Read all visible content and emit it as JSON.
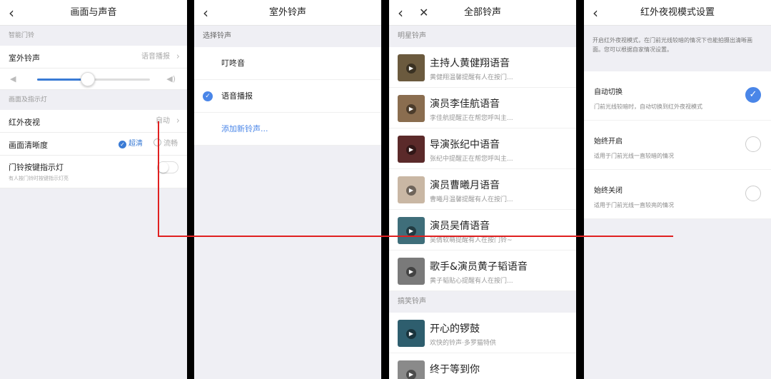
{
  "colors": {
    "accent": "#4a86e8",
    "annotation": "#e02020"
  },
  "screen1": {
    "title": "画面与声音",
    "section_smart_bell": "智能门铃",
    "outdoor_ring_label": "室外铃声",
    "outdoor_ring_value": "语音播报",
    "volume_level": 0.45,
    "section_picture": "画面及指示灯",
    "ir_night_label": "红外夜视",
    "ir_night_value": "自动",
    "clarity_label": "画面清晰度",
    "clarity_options": [
      "超清",
      "流畅"
    ],
    "clarity_selected": "超清",
    "indicator_label": "门铃按键指示灯",
    "indicator_sub": "有人按门铃时按键指示灯亮",
    "indicator_on": false
  },
  "screen2": {
    "title": "室外铃声",
    "section": "选择铃声",
    "options": [
      "叮咚音",
      "语音播报"
    ],
    "selected": "语音播报",
    "add_new": "添加新铃声..."
  },
  "screen3": {
    "title": "全部铃声",
    "section_star": "明星铃声",
    "star_items": [
      {
        "title": "主持人黄健翔语音",
        "sub": "黄健翔温馨提醒有人在按门...",
        "color": "#6b5a3e"
      },
      {
        "title": "演员李佳航语音",
        "sub": "李佳航提醒正在帮您呼叫主...",
        "color": "#8a6d4f"
      },
      {
        "title": "导演张纪中语音",
        "sub": "张纪中提醒正在帮您呼叫主...",
        "color": "#5b2a2a"
      },
      {
        "title": "演员曹曦月语音",
        "sub": "曹曦月温馨提醒有人在按门...",
        "color": "#c9b7a4"
      },
      {
        "title": "演员吴倩语音",
        "sub": "吴倩软萌提醒有人在按门铃~",
        "color": "#3f6e7a"
      },
      {
        "title": "歌手&演员黄子韬语音",
        "sub": "黄子韬贴心提醒有人在按门...",
        "color": "#7a7a7a"
      }
    ],
    "section_funny": "搞笑铃声",
    "funny_items": [
      {
        "title": "开心的锣鼓",
        "sub": "欢快的铃声·多罗猫特供",
        "color": "#2e5e6e"
      },
      {
        "title": "终于等到你",
        "sub": "",
        "color": "#8a8a8a"
      }
    ]
  },
  "screen4": {
    "title": "红外夜视模式设置",
    "description": "开启红外夜视模式，在门前光线较暗的情况下也能拍摄出清晰画面。您可以根据自家情况设置。",
    "modes": [
      {
        "title": "自动切换",
        "sub": "门前光线较暗时，自动切换到红外夜视模式",
        "selected": true
      },
      {
        "title": "始终开启",
        "sub": "适用于门前光线一直较暗的情况",
        "selected": false
      },
      {
        "title": "始终关闭",
        "sub": "适用于门前光线一直较亮的情况",
        "selected": false
      }
    ]
  }
}
